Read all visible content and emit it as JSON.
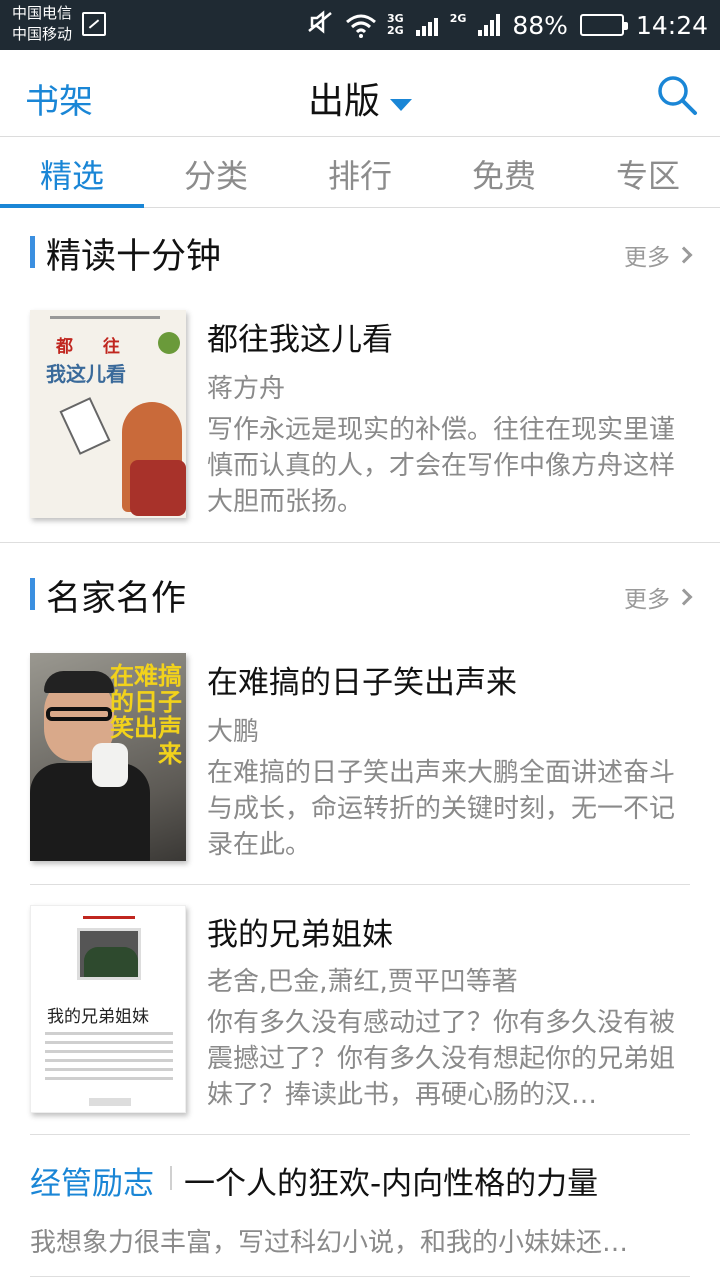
{
  "status_bar": {
    "carrier_1": "中国电信",
    "carrier_2": "中国移动",
    "net_top": "3G",
    "net_bottom": "2G",
    "net_2": "2G",
    "battery": "88%",
    "battery_level": 0.88,
    "time": "14:24",
    "icons": [
      "sim-icon",
      "mute-icon",
      "wifi-icon",
      "signal-icon",
      "battery-icon"
    ]
  },
  "header": {
    "left_label": "书架",
    "title": "出版",
    "icons": [
      "caret-down-icon",
      "search-icon"
    ]
  },
  "tabs": [
    {
      "label": "精选",
      "active": true
    },
    {
      "label": "分类",
      "active": false
    },
    {
      "label": "排行",
      "active": false
    },
    {
      "label": "免费",
      "active": false
    },
    {
      "label": "专区",
      "active": false
    }
  ],
  "sections": [
    {
      "title": "精读十分钟",
      "more": "更多",
      "books": [
        {
          "title": "都往我这儿看",
          "author": "蒋方舟",
          "desc": "写作永远是现实的补偿。往往在现实里谨慎而认真的人，才会在写作中像方舟这样大胆而张扬。",
          "cover_text_1": "都 往",
          "cover_text_2": "我这儿看"
        }
      ]
    },
    {
      "title": "名家名作",
      "more": "更多",
      "books": [
        {
          "title": "在难搞的日子笑出声来",
          "author": "大鹏",
          "desc": "在难搞的日子笑出声来大鹏全面讲述奋斗与成长，命运转折的关键时刻，无一不记录在此。",
          "cover_text": "在难搞的日子笑出声来"
        },
        {
          "title": "我的兄弟姐妹",
          "author": "老舍,巴金,萧红,贾平凹等著",
          "desc": "你有多久没有感动过了？你有多久没有被震撼过了？你有多久没有想起你的兄弟姐妹了？捧读此书，再硬心肠的汉…",
          "cover_text": "我的兄弟姐妹"
        }
      ],
      "extra": {
        "category": "经管励志",
        "title": "一个人的狂欢-内向性格的力量",
        "desc": "我想象力很丰富，写过科幻小说，和我的小妹妹还…"
      }
    }
  ],
  "colors": {
    "accent": "#1a86d6",
    "status_bar": "#1f2a33",
    "section_bar": "#3b8fe0"
  }
}
